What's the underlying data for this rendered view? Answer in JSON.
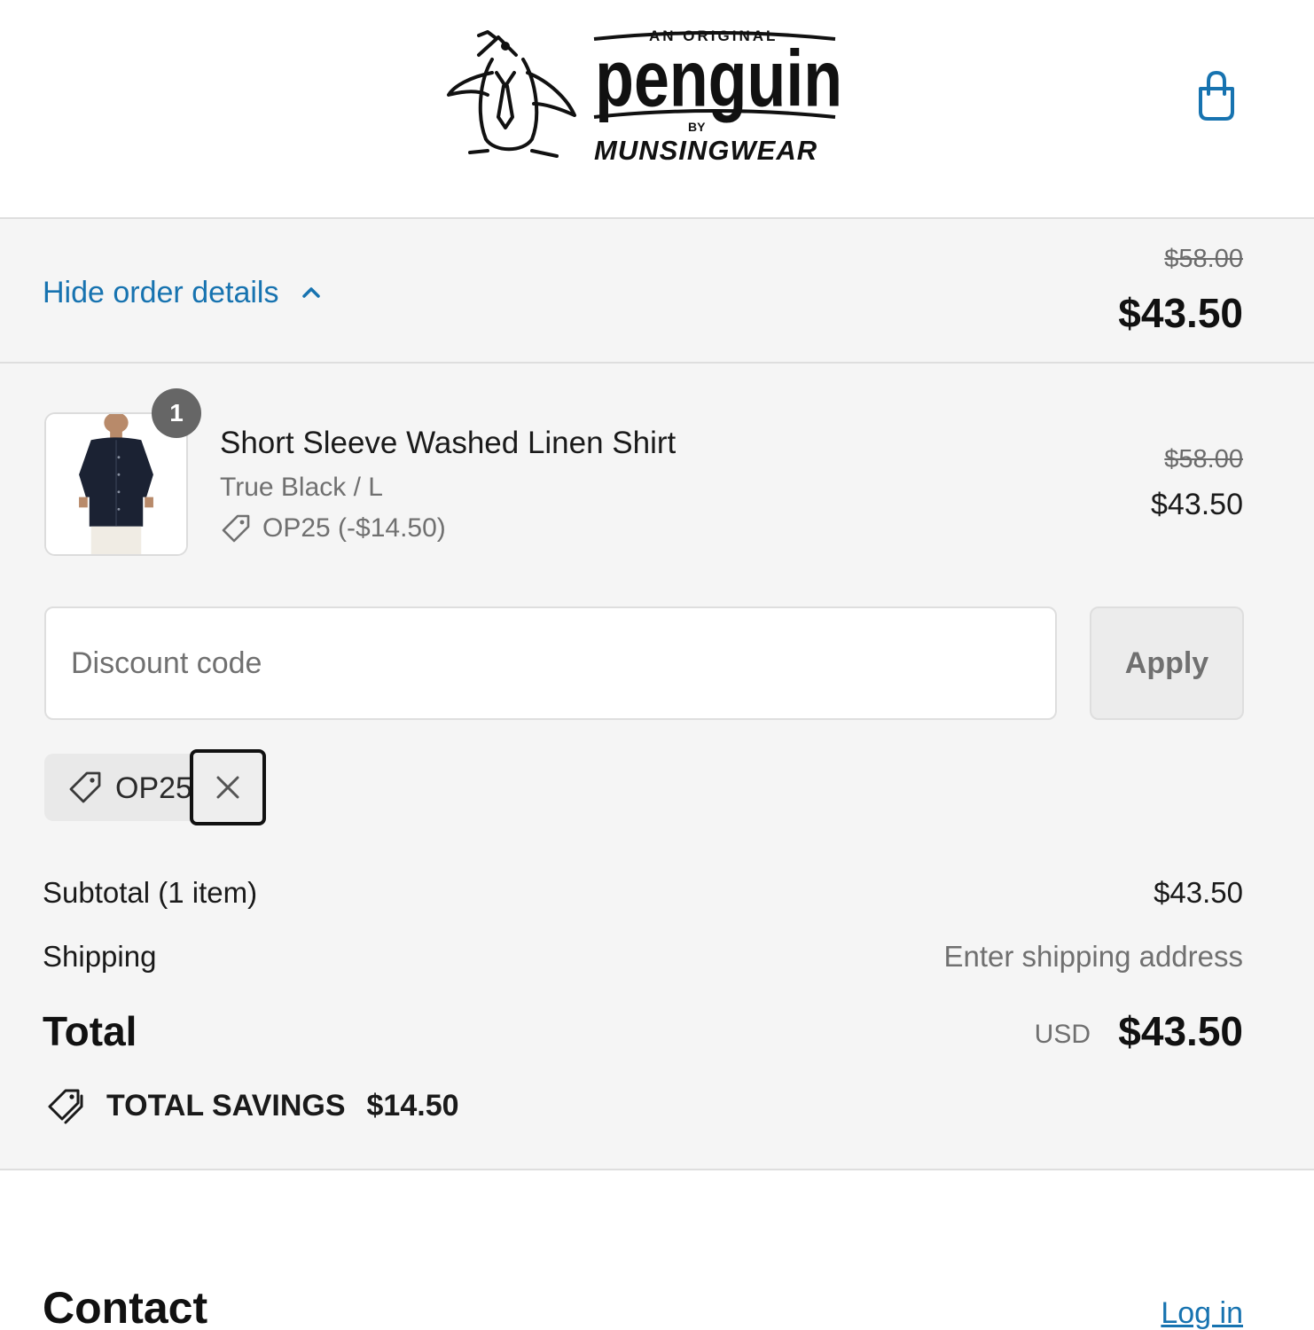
{
  "brand": {
    "name": "An Original Penguin by Munsingwear",
    "logo_top": "AN ORIGINAL",
    "logo_main": "penguin",
    "logo_by": "BY",
    "logo_bottom": "MUNSINGWEAR"
  },
  "header": {
    "cart_icon": "shopping-bag-icon",
    "accent_color": "#1773b0"
  },
  "summary_toggle": {
    "label": "Hide order details",
    "icon": "chevron-up-icon",
    "original_price": "$58.00",
    "price": "$43.50"
  },
  "line_item": {
    "quantity": "1",
    "title": "Short Sleeve Washed Linen Shirt",
    "variant": "True Black / L",
    "discount": "OP25 (-$14.50)",
    "original_price": "$58.00",
    "price": "$43.50",
    "image": "shirt-thumbnail"
  },
  "discount_form": {
    "placeholder": "Discount code",
    "value": "",
    "apply_label": "Apply"
  },
  "applied_code": {
    "code": "OP25",
    "remove_icon": "close-icon"
  },
  "totals": {
    "subtotal_label": "Subtotal (1 item)",
    "subtotal_value": "$43.50",
    "shipping_label": "Shipping",
    "shipping_value": "Enter shipping address",
    "total_label": "Total",
    "currency": "USD",
    "total_value": "$43.50",
    "savings_label": "TOTAL SAVINGS",
    "savings_value": "$14.50"
  },
  "contact": {
    "heading": "Contact",
    "login_label": "Log in"
  }
}
